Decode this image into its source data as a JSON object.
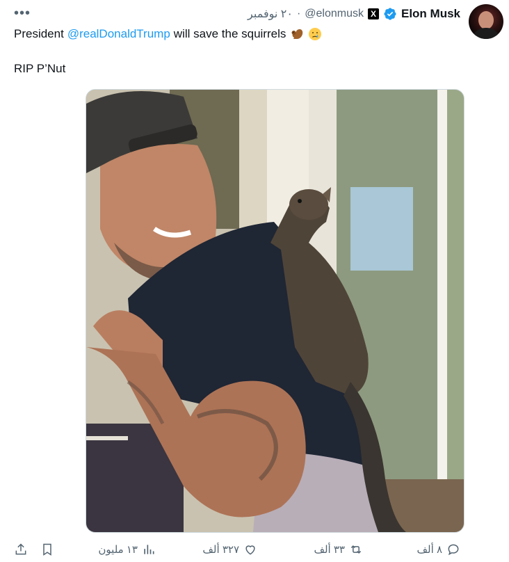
{
  "tweet": {
    "author": {
      "name": "Elon Musk",
      "handle": "@elonmusk",
      "date": "٢٠ نوفمبر",
      "badge_letter": "X"
    },
    "text": {
      "prefix": "President",
      "mention": "@realDonaldTrump",
      "suffix": "will save the squirrels",
      "line2": "RIP P’Nut"
    },
    "colors": {
      "accent": "#1d9bf0",
      "text": "#0f1419",
      "muted": "#536471"
    },
    "stats": {
      "replies": "٨ ألف",
      "retweets": "٣٣ ألف",
      "likes": "٣٢٧ ألف",
      "views": "١٣ مليون"
    },
    "icons": [
      "more-icon",
      "verified-icon",
      "x-badge-icon",
      "squirrel-emoji",
      "crying-face-emoji",
      "reply-icon",
      "retweet-icon",
      "like-icon",
      "views-icon",
      "bookmark-icon",
      "share-icon"
    ]
  }
}
